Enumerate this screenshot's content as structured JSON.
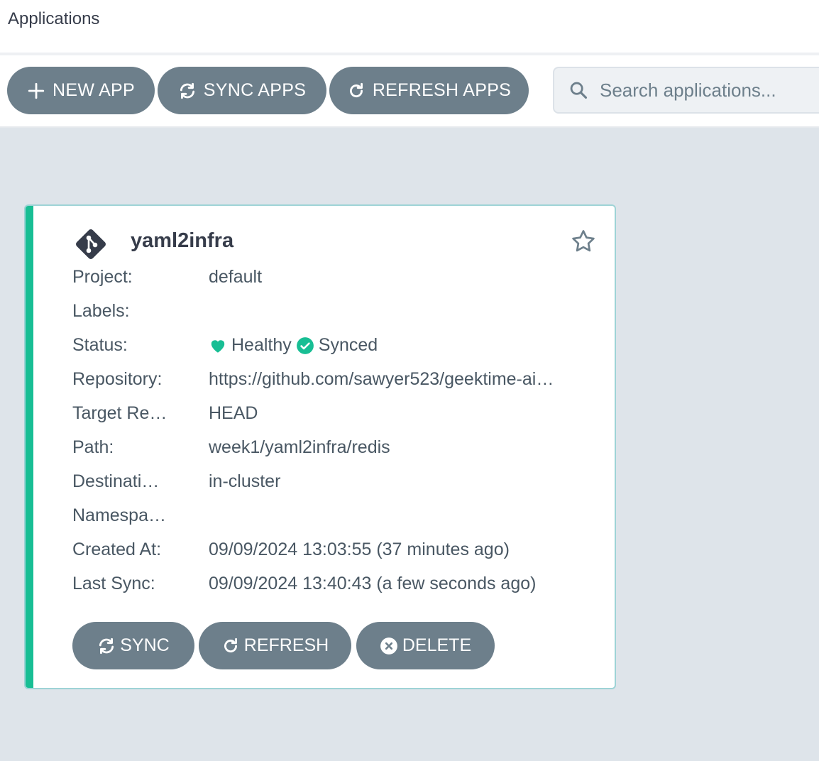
{
  "header": {
    "title": "Applications"
  },
  "toolbar": {
    "new_app_label": "NEW APP",
    "sync_apps_label": "SYNC APPS",
    "refresh_apps_label": "REFRESH APPS",
    "search_placeholder": "Search applications..."
  },
  "app": {
    "name": "yaml2infra",
    "icon": "git-icon",
    "favorite_icon": "star-icon",
    "fields": {
      "project": {
        "label": "Project:",
        "value": "default"
      },
      "labels": {
        "label": "Labels:",
        "value": ""
      },
      "status": {
        "label": "Status:",
        "health": "Healthy",
        "sync": "Synced"
      },
      "repository": {
        "label": "Repository:",
        "value": "https://github.com/sawyer523/geektime-ai…"
      },
      "target_revision": {
        "label": "Target Re…",
        "value": "HEAD"
      },
      "path": {
        "label": "Path:",
        "value": "week1/yaml2infra/redis"
      },
      "destination": {
        "label": "Destinati…",
        "value": "in-cluster"
      },
      "namespace": {
        "label": "Namespa…",
        "value": ""
      },
      "created_at": {
        "label": "Created At:",
        "value": "09/09/2024 13:03:55  (37 minutes ago)"
      },
      "last_sync": {
        "label": "Last Sync:",
        "value": "09/09/2024 13:40:43  (a few seconds ago)"
      }
    },
    "actions": {
      "sync": "SYNC",
      "refresh": "REFRESH",
      "delete": "DELETE"
    }
  },
  "colors": {
    "accent_healthy": "#18be94",
    "button_bg": "#6d7f8b",
    "content_bg": "#dee4ea",
    "text": "#363c4a"
  }
}
